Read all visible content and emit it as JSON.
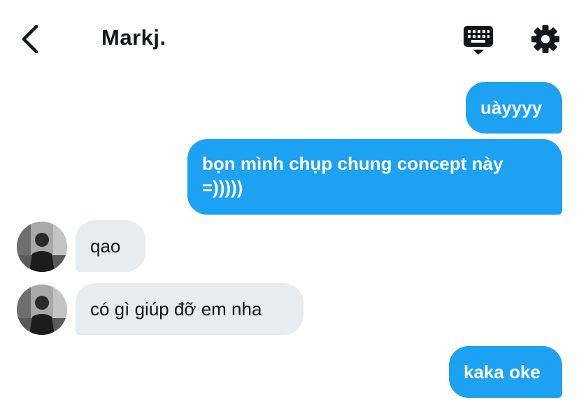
{
  "header": {
    "contact_name": "Markj.",
    "back_icon": "chevron-left-icon",
    "keyboard_icon": "keyboard-icon",
    "settings_icon": "gear-icon"
  },
  "colors": {
    "outgoing_bubble": "#1da1f2",
    "incoming_bubble": "#e6ecf0",
    "text_dark": "#14171a"
  },
  "messages": [
    {
      "direction": "outgoing",
      "text": "uàyyyy"
    },
    {
      "direction": "outgoing",
      "lines": [
        "bọn mình chụp chung concept này",
        "=)))))"
      ]
    },
    {
      "direction": "incoming",
      "text": "qao"
    },
    {
      "direction": "incoming",
      "text": "có gì giúp đỡ em nha"
    },
    {
      "direction": "outgoing",
      "text": "kaka oke"
    }
  ]
}
